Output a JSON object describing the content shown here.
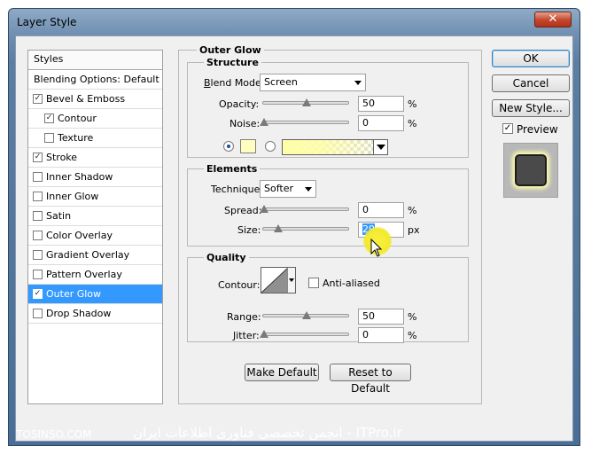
{
  "window": {
    "title": "Layer Style",
    "close": "✕"
  },
  "styles_list": {
    "header": "Styles",
    "items": [
      {
        "label": "Blending Options: Default",
        "checkbox": false,
        "checked": false,
        "sub": false,
        "selected": false
      },
      {
        "label": "Bevel & Emboss",
        "checkbox": true,
        "checked": true,
        "sub": false,
        "selected": false
      },
      {
        "label": "Contour",
        "checkbox": true,
        "checked": true,
        "sub": true,
        "selected": false
      },
      {
        "label": "Texture",
        "checkbox": true,
        "checked": false,
        "sub": true,
        "selected": false
      },
      {
        "label": "Stroke",
        "checkbox": true,
        "checked": true,
        "sub": false,
        "selected": false
      },
      {
        "label": "Inner Shadow",
        "checkbox": true,
        "checked": false,
        "sub": false,
        "selected": false
      },
      {
        "label": "Inner Glow",
        "checkbox": true,
        "checked": false,
        "sub": false,
        "selected": false
      },
      {
        "label": "Satin",
        "checkbox": true,
        "checked": false,
        "sub": false,
        "selected": false
      },
      {
        "label": "Color Overlay",
        "checkbox": true,
        "checked": false,
        "sub": false,
        "selected": false
      },
      {
        "label": "Gradient Overlay",
        "checkbox": true,
        "checked": false,
        "sub": false,
        "selected": false
      },
      {
        "label": "Pattern Overlay",
        "checkbox": true,
        "checked": false,
        "sub": false,
        "selected": false
      },
      {
        "label": "Outer Glow",
        "checkbox": true,
        "checked": true,
        "sub": false,
        "selected": true
      },
      {
        "label": "Drop Shadow",
        "checkbox": true,
        "checked": false,
        "sub": false,
        "selected": false
      }
    ]
  },
  "panel": {
    "title": "Outer Glow",
    "structure": {
      "title": "Structure",
      "blend_mode_label": "Blend Mode:",
      "blend_mode_value": "Screen",
      "opacity_label": "Opacity:",
      "opacity_value": "50",
      "opacity_unit": "%",
      "noise_label": "Noise:",
      "noise_value": "0",
      "noise_unit": "%",
      "glow_color": "#fffec0"
    },
    "elements": {
      "title": "Elements",
      "technique_label": "Technique:",
      "technique_value": "Softer",
      "spread_label": "Spread:",
      "spread_value": "0",
      "spread_unit": "%",
      "size_label": "Size:",
      "size_value": "29",
      "size_unit": "px"
    },
    "quality": {
      "title": "Quality",
      "contour_label": "Contour:",
      "anti_aliased_label": "Anti-aliased",
      "range_label": "Range:",
      "range_value": "50",
      "range_unit": "%",
      "jitter_label": "Jitter:",
      "jitter_value": "0",
      "jitter_unit": "%"
    },
    "make_default": "Make Default",
    "reset_default": "Reset to Default"
  },
  "buttons": {
    "ok": "OK",
    "cancel": "Cancel",
    "new_style": "New Style...",
    "preview_label": "Preview",
    "preview_checked": true
  },
  "watermark": {
    "left": "TOSINSO.COM",
    "right": "انجمن تخصصی فناوری اطلاعات ایران - ITPro.ir"
  }
}
